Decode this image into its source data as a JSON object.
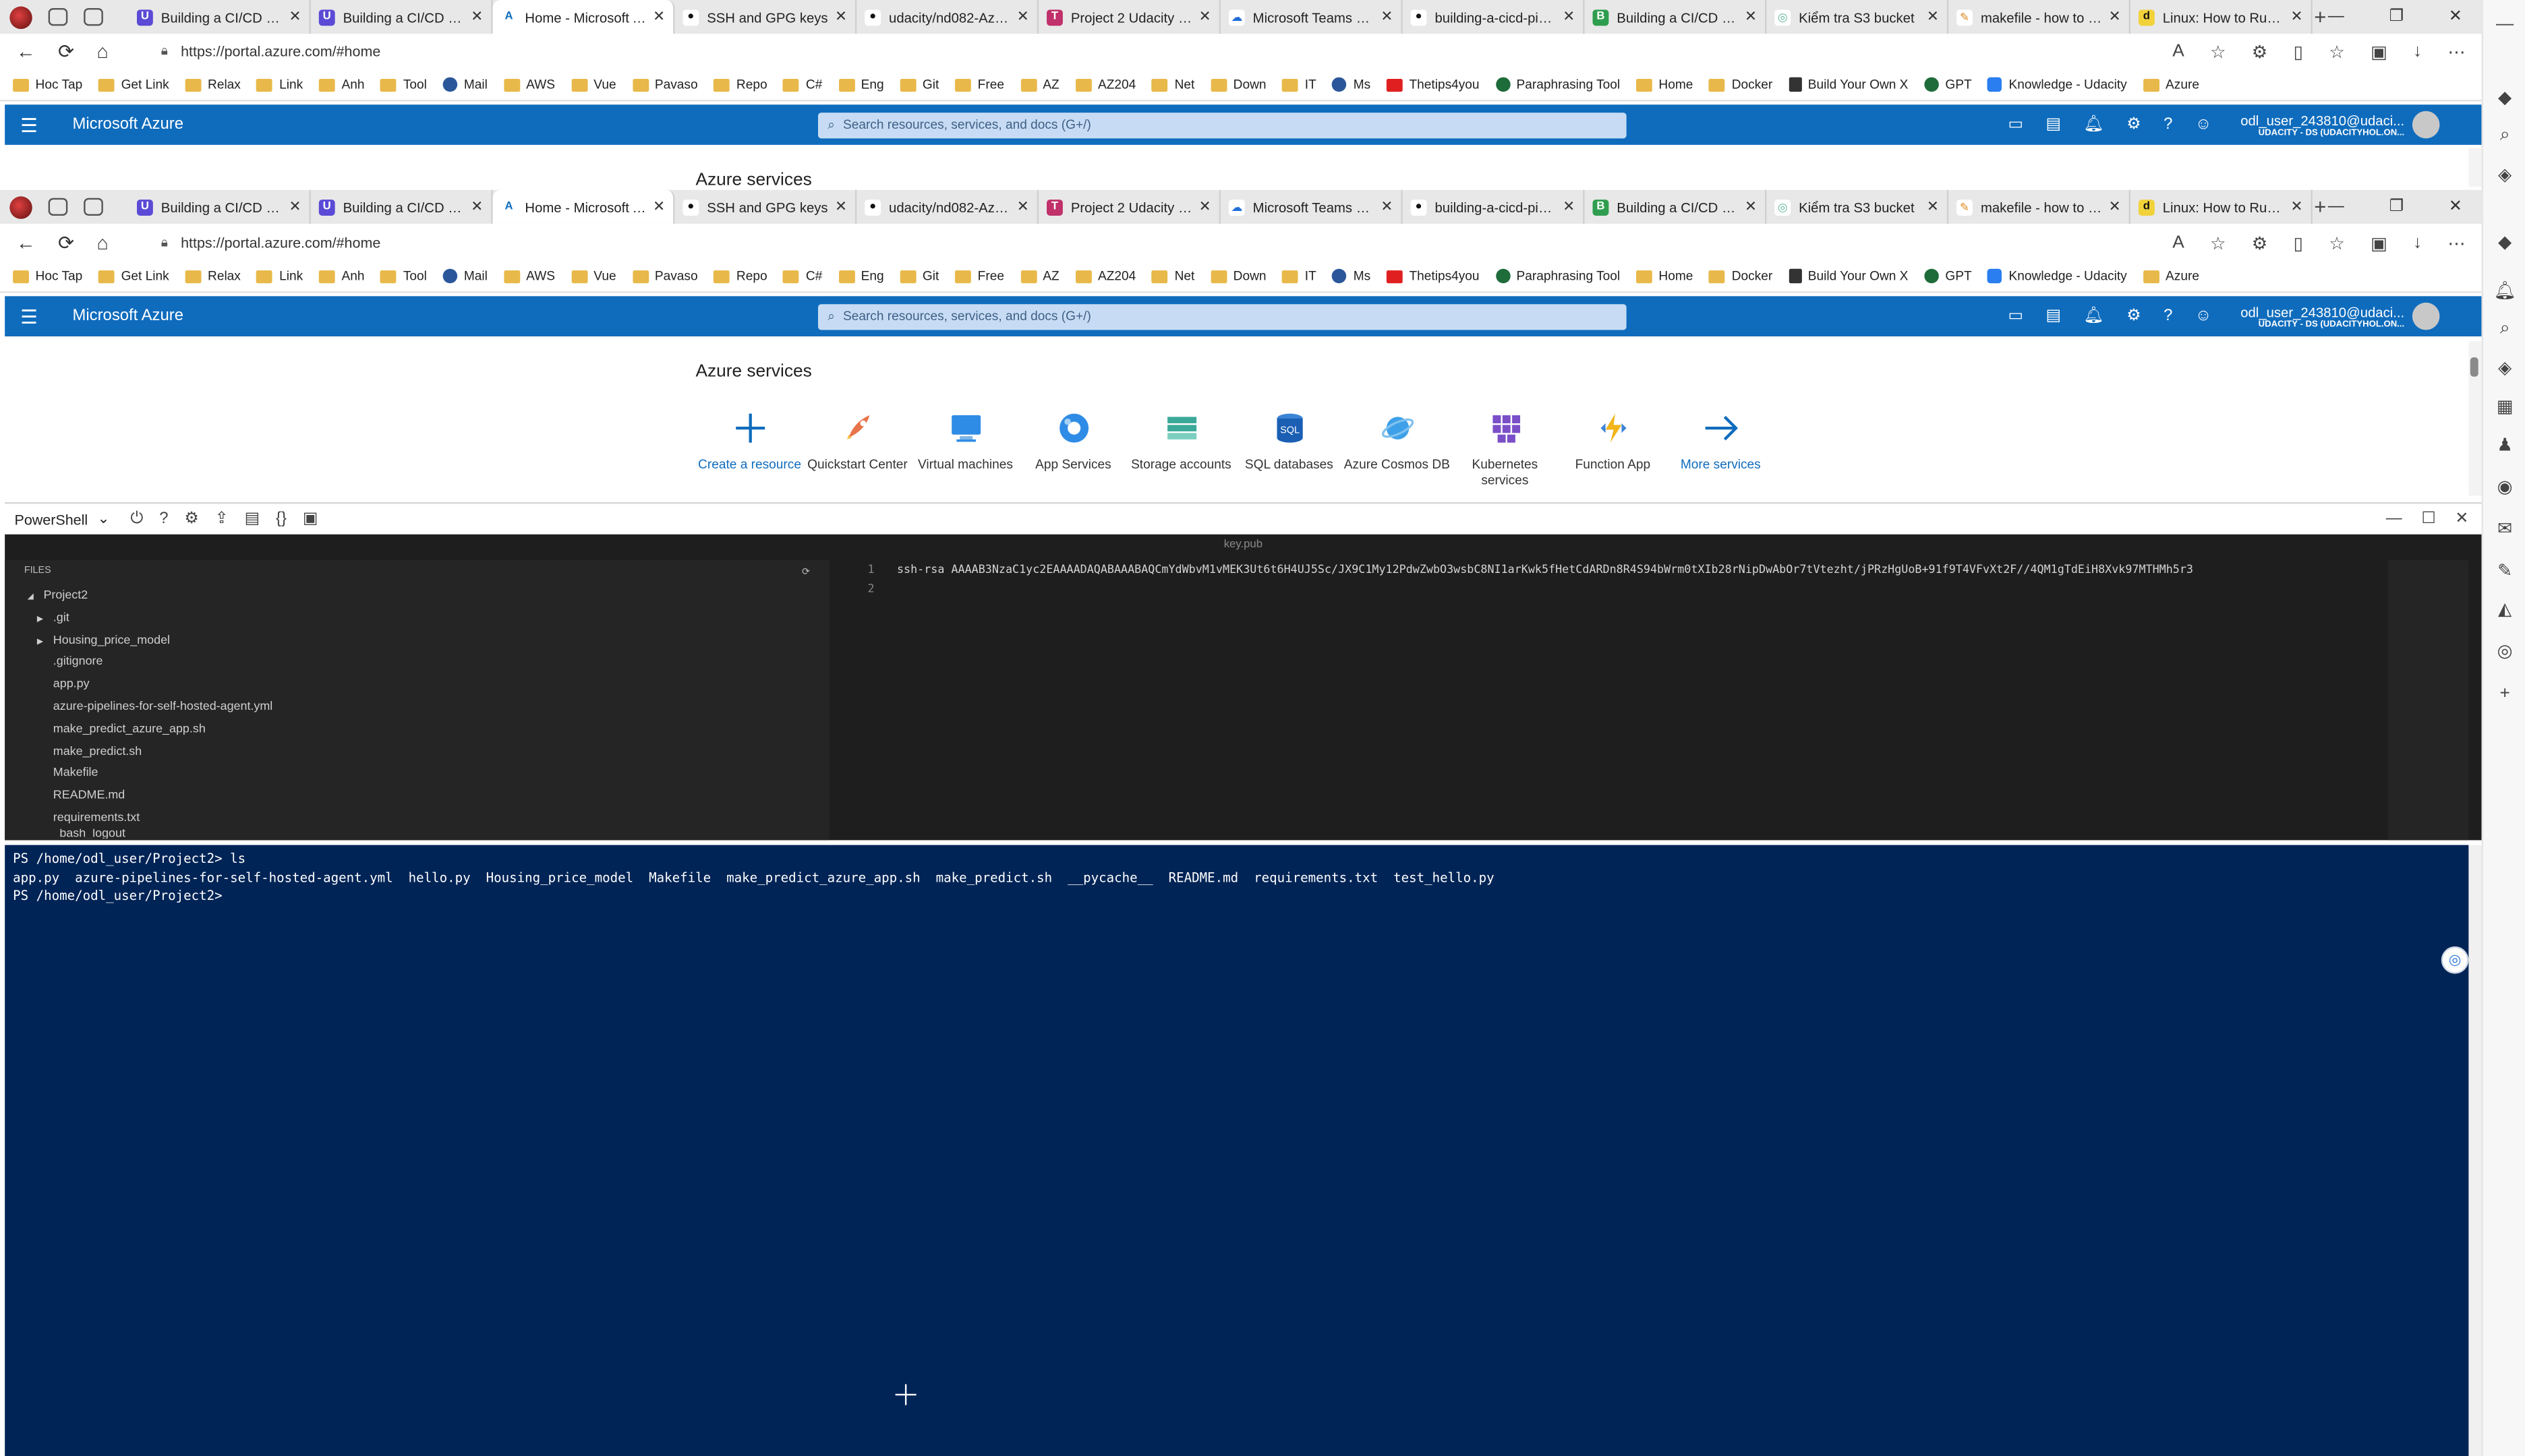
{
  "tabs": [
    {
      "title": "Building a CI/CD Pipe",
      "fav": "U",
      "favBg": "#5b4ad6",
      "favColor": "#ffffff"
    },
    {
      "title": "Building a CI/CD Pipe",
      "fav": "U",
      "favBg": "#5b4ad6",
      "favColor": "#ffffff"
    },
    {
      "title": "Home - Microsoft Az",
      "fav": "A",
      "favBg": "#ffffff",
      "favColor": "#0f6cbd",
      "active": true
    },
    {
      "title": "SSH and GPG keys",
      "fav": "●",
      "favBg": "#ffffff",
      "favColor": "#111111"
    },
    {
      "title": "udacity/nd082-Azure",
      "fav": "●",
      "favBg": "#ffffff",
      "favColor": "#111111"
    },
    {
      "title": "Project 2 Udacity | Tre",
      "fav": "T",
      "favBg": "#c0306a",
      "favColor": "#ffffff"
    },
    {
      "title": "Microsoft Teams Chat",
      "fav": "☁",
      "favBg": "#ffffff",
      "favColor": "#1e6ed8"
    },
    {
      "title": "building-a-cicd-pipeli",
      "fav": "●",
      "favBg": "#ffffff",
      "favColor": "#111111"
    },
    {
      "title": "Building a CI/CD Pipe",
      "fav": "B",
      "favBg": "#2e9e4e",
      "favColor": "#ffffff"
    },
    {
      "title": "Kiểm tra S3 bucket",
      "fav": "◎",
      "favBg": "#ffffff",
      "favColor": "#5db89a"
    },
    {
      "title": "makefile - how to \"ex",
      "fav": "✎",
      "favBg": "#ffffff",
      "favColor": "#e08a1e"
    },
    {
      "title": "Linux: How to Run m",
      "fav": "d",
      "favBg": "#f2d23a",
      "favColor": "#111111"
    }
  ],
  "address": {
    "url": "https://portal.azure.com/#home"
  },
  "bookmarks": [
    {
      "label": "Hoc Tap",
      "kind": ""
    },
    {
      "label": "Get Link",
      "kind": ""
    },
    {
      "label": "Relax",
      "kind": ""
    },
    {
      "label": "Link",
      "kind": ""
    },
    {
      "label": "Anh",
      "kind": ""
    },
    {
      "label": "Tool",
      "kind": ""
    },
    {
      "label": "Mail",
      "kind": "ms"
    },
    {
      "label": "AWS",
      "kind": ""
    },
    {
      "label": "Vue",
      "kind": ""
    },
    {
      "label": "Pavaso",
      "kind": ""
    },
    {
      "label": "Repo",
      "kind": ""
    },
    {
      "label": "C#",
      "kind": ""
    },
    {
      "label": "Eng",
      "kind": ""
    },
    {
      "label": "Git",
      "kind": ""
    },
    {
      "label": "Free",
      "kind": ""
    },
    {
      "label": "AZ",
      "kind": ""
    },
    {
      "label": "AZ204",
      "kind": ""
    },
    {
      "label": "Net",
      "kind": ""
    },
    {
      "label": "Down",
      "kind": ""
    },
    {
      "label": "IT",
      "kind": ""
    },
    {
      "label": "Ms",
      "kind": "ms"
    },
    {
      "label": "Thetips4you",
      "kind": "yt"
    },
    {
      "label": "Paraphrasing Tool",
      "kind": "gr"
    },
    {
      "label": "Home",
      "kind": ""
    },
    {
      "label": "Docker",
      "kind": ""
    },
    {
      "label": "Build Your Own X",
      "kind": "bk"
    },
    {
      "label": "GPT",
      "kind": "gr"
    },
    {
      "label": "Knowledge - Udacity",
      "kind": "ud"
    },
    {
      "label": "Azure",
      "kind": ""
    }
  ],
  "azure": {
    "brand": "Microsoft Azure",
    "search_placeholder": "Search resources, services, and docs (G+/)",
    "user_name": "odl_user_243810@udaci...",
    "user_dir": "UDACITY - DS (UDACITYHOL.ON...",
    "services_title": "Azure services",
    "services": [
      {
        "label": "Create a resource",
        "icon": "plus",
        "link": true
      },
      {
        "label": "Quickstart Center",
        "icon": "rocket",
        "link": false
      },
      {
        "label": "Virtual machines",
        "icon": "vm",
        "link": false
      },
      {
        "label": "App Services",
        "icon": "app",
        "link": false
      },
      {
        "label": "Storage accounts",
        "icon": "storage",
        "link": false
      },
      {
        "label": "SQL databases",
        "icon": "sql",
        "link": false
      },
      {
        "label": "Azure Cosmos DB",
        "icon": "cosmos",
        "link": false
      },
      {
        "label": "Kubernetes services",
        "icon": "k8s",
        "link": false
      },
      {
        "label": "Function App",
        "icon": "func",
        "link": false
      },
      {
        "label": "More services",
        "icon": "arrow",
        "link": true
      }
    ]
  },
  "cloudshell": {
    "shell": "PowerShell",
    "file_title": "key.pub",
    "files_header": "FILES",
    "files": [
      {
        "name": "Project2",
        "depth": 0,
        "arrow": "◢"
      },
      {
        "name": ".git",
        "depth": 1,
        "arrow": "▶"
      },
      {
        "name": "Housing_price_model",
        "depth": 1,
        "arrow": "▶"
      },
      {
        "name": ".gitignore",
        "depth": 1,
        "arrow": ""
      },
      {
        "name": "app.py",
        "depth": 1,
        "arrow": ""
      },
      {
        "name": "azure-pipelines-for-self-hosted-agent.yml",
        "depth": 1,
        "arrow": ""
      },
      {
        "name": "make_predict_azure_app.sh",
        "depth": 1,
        "arrow": ""
      },
      {
        "name": "make_predict.sh",
        "depth": 1,
        "arrow": ""
      },
      {
        "name": "Makefile",
        "depth": 1,
        "arrow": ""
      },
      {
        "name": "README.md",
        "depth": 1,
        "arrow": ""
      },
      {
        "name": "requirements.txt",
        "depth": 1,
        "arrow": ""
      },
      {
        "name": "bash_logout",
        "depth": 0,
        "arrow": ""
      }
    ],
    "code_lines": [
      {
        "n": "1",
        "text": "ssh-rsa AAAAB3NzaC1yc2EAAAADAQABAAABAQCmYdWbvM1vMEK3Ut6t6H4UJ5Sc/JX9C1My12PdwZwbO3wsbC8NI1arKwk5fHetCdARDn8R4S94bWrm0tXIb28rNipDwAbOr7tVtezht/jPRzHgUoB+91f9T4VFvXt2F//4QM1gTdEiH8Xvk97MTHMh5r3"
      },
      {
        "n": "2",
        "text": ""
      }
    ],
    "terminal": [
      "PS /home/odl_user/Project2> ls",
      "app.py  azure-pipelines-for-self-hosted-agent.yml  hello.py  Housing_price_model  Makefile  make_predict_azure_app.sh  make_predict.sh  __pycache__  README.md  requirements.txt  test_hello.py",
      "PS /home/odl_user/Project2> "
    ]
  }
}
